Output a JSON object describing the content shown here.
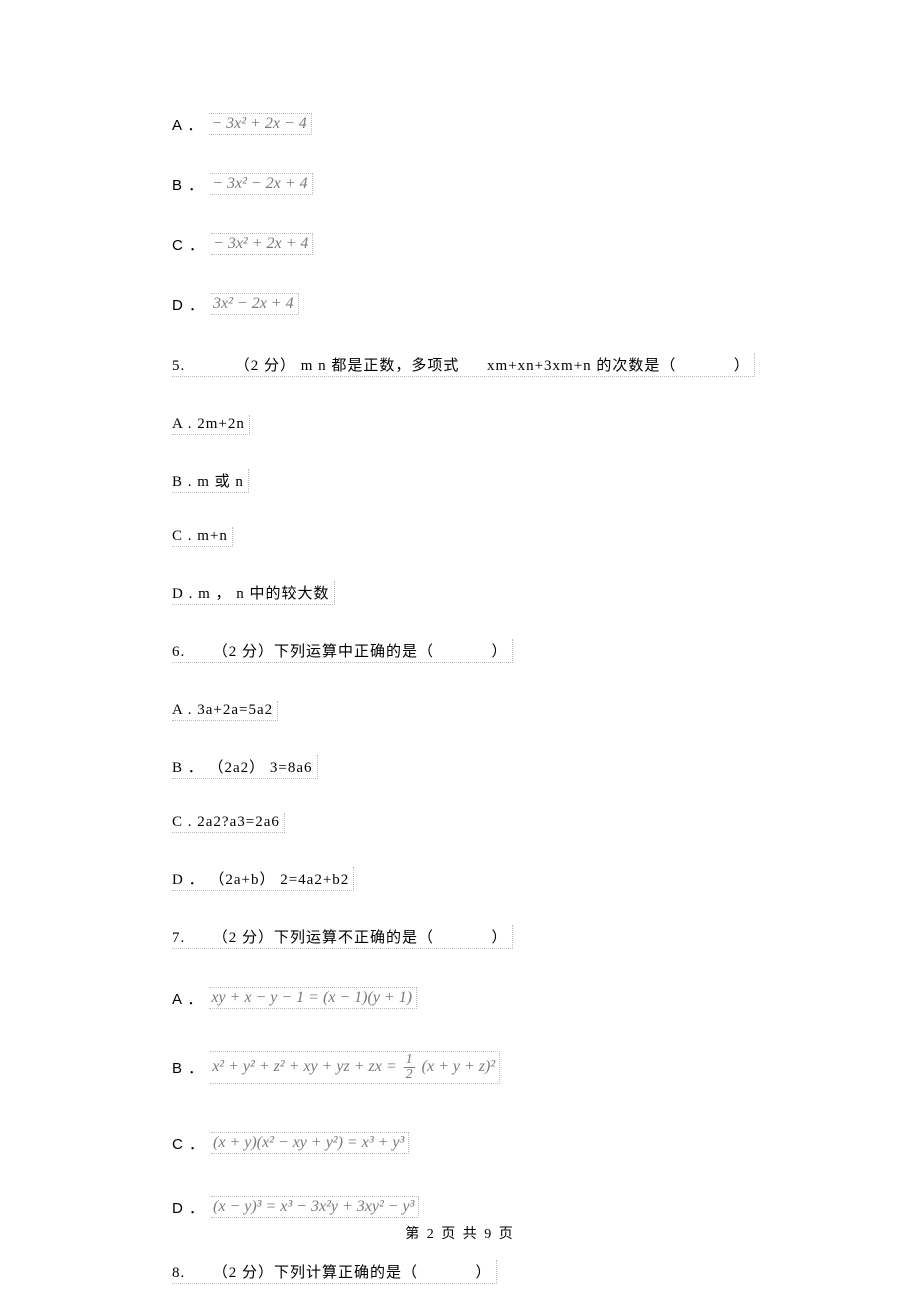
{
  "q4_options": {
    "A": {
      "label": "A ．",
      "math": "− 3x² + 2x − 4"
    },
    "B": {
      "label": "B ．",
      "math": "− 3x² − 2x + 4"
    },
    "C": {
      "label": "C ．",
      "math": "− 3x² + 2x + 4"
    },
    "D": {
      "label": "D ．",
      "math": "3x² − 2x + 4"
    }
  },
  "q5": {
    "number": "5.",
    "points": "（2 分）",
    "prefix": "m  n 都是正数，多项式",
    "term": "xm+xn+3xm+n",
    "suffix": "的次数是（",
    "close": "）",
    "options": {
      "A": "A . 2m+2n",
      "B": "B . m  或  n",
      "C": "C . m+n",
      "D": "D . m ，  n 中的较大数"
    }
  },
  "q6": {
    "number": "6.",
    "points": "（2 分）下列运算中正确的是（",
    "close": "）",
    "options": {
      "A": "A . 3a+2a=5a2",
      "B": "B ． （2a2） 3=8a6",
      "C": "C . 2a2?a3=2a6",
      "D": "D ． （2a+b） 2=4a2+b2"
    }
  },
  "q7": {
    "number": "7.",
    "points": "（2 分）下列运算不正确的是（",
    "close": "）",
    "options": {
      "A": {
        "label": "A ．",
        "math": "xy + x − y − 1 = (x − 1)(y + 1)"
      },
      "B": {
        "label": "B ．",
        "math_left": "x² + y² + z² + xy + yz + zx =",
        "math_right": "(x + y + z)²"
      },
      "C": {
        "label": "C ．",
        "math": "(x + y)(x² − xy + y²) = x³ + y³"
      },
      "D": {
        "label": "D ．",
        "math": "(x − y)³ = x³ − 3x²y + 3xy² − y³"
      }
    }
  },
  "q8": {
    "number": "8.",
    "points": "（2 分）下列计算正确的是（",
    "close": "）"
  },
  "footer": "第  2 页  共  9 页"
}
